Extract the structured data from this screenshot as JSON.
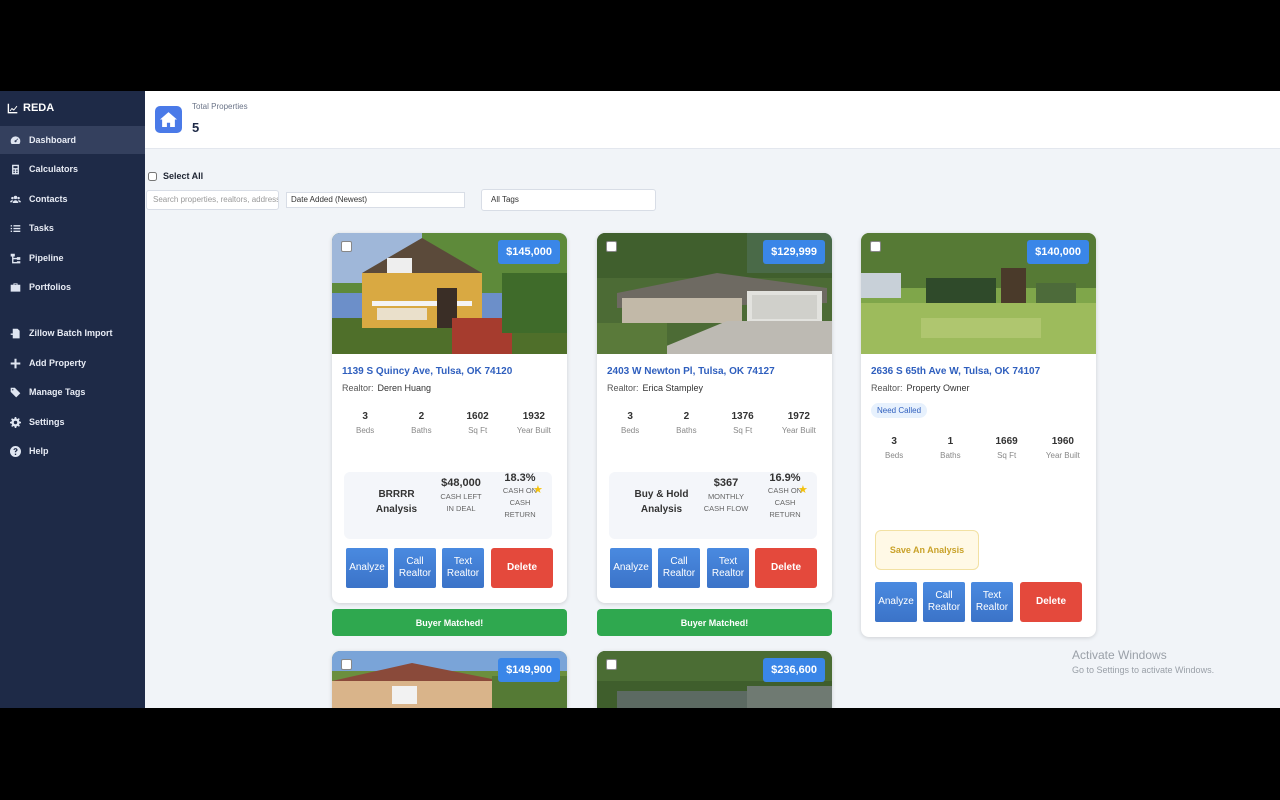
{
  "app": {
    "name": "REDA"
  },
  "sidebar": {
    "items": [
      {
        "label": "Dashboard",
        "icon": "dashboard-icon"
      },
      {
        "label": "Calculators",
        "icon": "calculator-icon"
      },
      {
        "label": "Contacts",
        "icon": "users-icon"
      },
      {
        "label": "Tasks",
        "icon": "list-icon"
      },
      {
        "label": "Pipeline",
        "icon": "sitemap-icon"
      },
      {
        "label": "Portfolios",
        "icon": "briefcase-icon"
      },
      {
        "label": "Zillow Batch Import",
        "icon": "import-icon"
      },
      {
        "label": "Add Property",
        "icon": "plus-icon"
      },
      {
        "label": "Manage Tags",
        "icon": "tags-icon"
      },
      {
        "label": "Settings",
        "icon": "gear-icon"
      },
      {
        "label": "Help",
        "icon": "help-icon"
      }
    ]
  },
  "header": {
    "total_label": "Total Properties",
    "total_value": "5"
  },
  "toolbar": {
    "select_all": "Select All",
    "search_placeholder": "Search properties, realtors, address...",
    "sort_value": "Date Added (Newest)",
    "tags_value": "All Tags"
  },
  "cards": [
    {
      "price": "$145,000",
      "address": "1139 S Quincy Ave, Tulsa, OK 74120",
      "realtor_label": "Realtor:",
      "realtor": "Deren Huang",
      "stats": [
        {
          "value": "3",
          "label": "Beds"
        },
        {
          "value": "2",
          "label": "Baths"
        },
        {
          "value": "1602",
          "label": "Sq Ft"
        },
        {
          "value": "1932",
          "label": "Year Built"
        }
      ],
      "analysis": {
        "title": "BRRRR Analysis",
        "value": "$48,000",
        "value_label": "CASH LEFT IN DEAL",
        "pct": "18.3%",
        "pct_label": "CASH ON CASH RETURN"
      },
      "buttons": {
        "analyze": "Analyze",
        "call": "Call Realtor",
        "text": "Text Realtor",
        "delete": "Delete"
      },
      "banner": "Buyer Matched!"
    },
    {
      "price": "$129,999",
      "address": "2403 W Newton Pl, Tulsa, OK 74127",
      "realtor_label": "Realtor:",
      "realtor": "Erica Stampley",
      "stats": [
        {
          "value": "3",
          "label": "Beds"
        },
        {
          "value": "2",
          "label": "Baths"
        },
        {
          "value": "1376",
          "label": "Sq Ft"
        },
        {
          "value": "1972",
          "label": "Year Built"
        }
      ],
      "analysis": {
        "title": "Buy & Hold Analysis",
        "value": "$367",
        "value_label": "MONTHLY CASH FLOW",
        "pct": "16.9%",
        "pct_label": "CASH ON CASH RETURN"
      },
      "buttons": {
        "analyze": "Analyze",
        "call": "Call Realtor",
        "text": "Text Realtor",
        "delete": "Delete"
      },
      "banner": "Buyer Matched!"
    },
    {
      "price": "$140,000",
      "address": "2636 S 65th Ave W, Tulsa, OK 74107",
      "realtor_label": "Realtor:",
      "realtor": "Property Owner",
      "tag": "Need Called",
      "stats": [
        {
          "value": "3",
          "label": "Beds"
        },
        {
          "value": "1",
          "label": "Baths"
        },
        {
          "value": "1669",
          "label": "Sq Ft"
        },
        {
          "value": "1960",
          "label": "Year Built"
        }
      ],
      "save_analysis": "Save An Analysis",
      "buttons": {
        "analyze": "Analyze",
        "call": "Call Realtor",
        "text": "Text Realtor",
        "delete": "Delete"
      }
    },
    {
      "price": "$149,900"
    },
    {
      "price": "$236,600"
    }
  ],
  "watermark": {
    "line1": "Activate Windows",
    "line2": "Go to Settings to activate Windows."
  },
  "colors": {
    "sidebar": "#1e2a47",
    "accent": "#3a86e8",
    "danger": "#e4493c",
    "success": "#2fa84f"
  }
}
